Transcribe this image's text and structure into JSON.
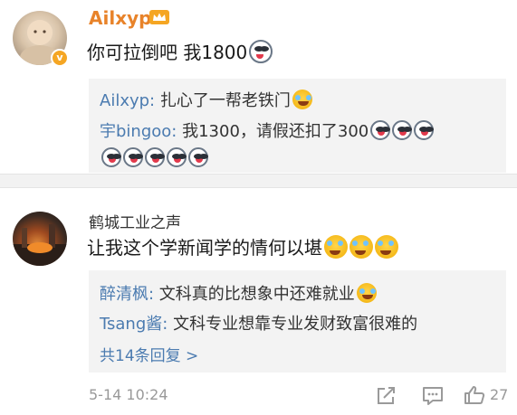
{
  "comment1": {
    "username": "Ailxyp",
    "text": "你可拉倒吧 我1800",
    "replies": [
      {
        "author": "Ailxyp",
        "sep": ":",
        "text": " 扎心了一帮老铁门"
      },
      {
        "author": "宇bingoo",
        "sep": ":",
        "text": " 我1300，请假还扣了300"
      }
    ]
  },
  "comment2": {
    "username": "鹤城工业之声",
    "text": "让我这个学新闻学的情何以堪",
    "replies": [
      {
        "author": "醉清枫",
        "sep": ":",
        "text": " 文科真的比想象中还难就业"
      },
      {
        "author": "Tsang酱",
        "sep": ":",
        "text": " 文科专业想靠专业发财致富很难的"
      }
    ],
    "more_replies": "共14条回复 >",
    "timestamp": "5-14 10:24",
    "like_count": "27"
  },
  "colors": {
    "vip_name": "#e8832a",
    "reply_author": "#4b7bb0",
    "reply_bg": "#f3f3f3",
    "meta_gray": "#999999"
  }
}
